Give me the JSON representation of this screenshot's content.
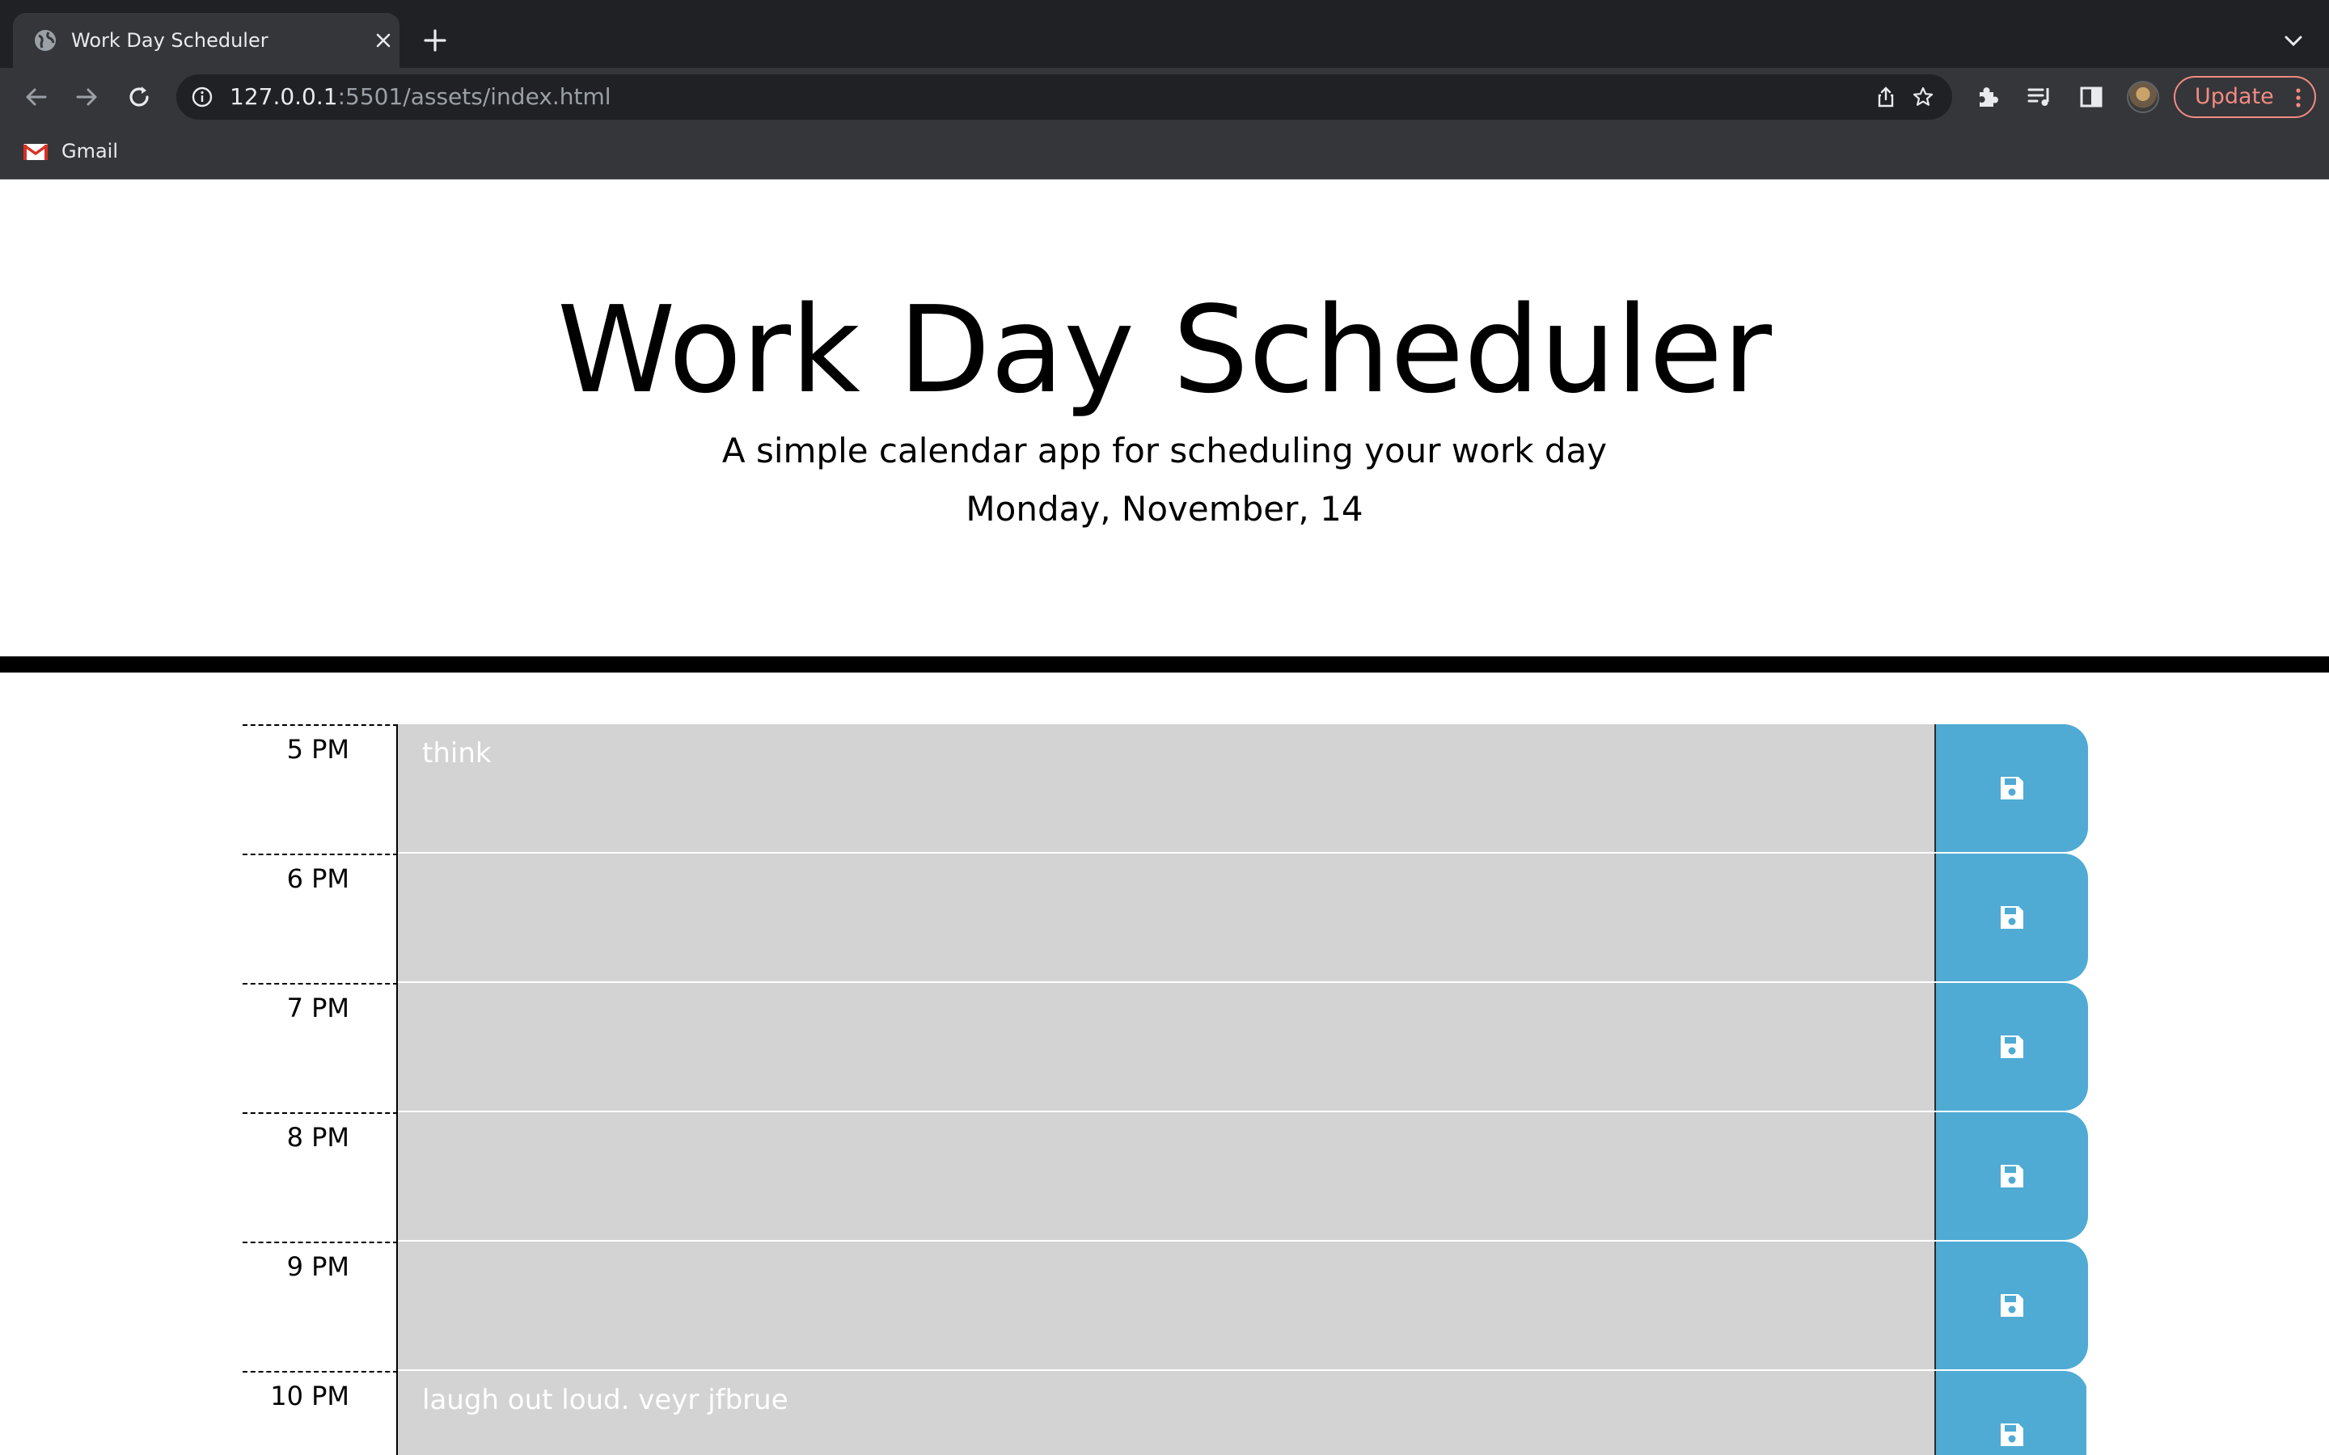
{
  "browser": {
    "tab_title": "Work Day Scheduler",
    "url_host": "127.0.0.1",
    "url_rest": ":5501/assets/index.html",
    "update_label": "Update",
    "bookmarks": [
      {
        "label": "Gmail"
      }
    ]
  },
  "header": {
    "title": "Work Day Scheduler",
    "lead": "A simple calendar app for scheduling your work day",
    "current_day": "Monday, November, 14"
  },
  "time_blocks": [
    {
      "hour": "5 PM",
      "text": "think"
    },
    {
      "hour": "6 PM",
      "text": ""
    },
    {
      "hour": "7 PM",
      "text": ""
    },
    {
      "hour": "8 PM",
      "text": ""
    },
    {
      "hour": "9 PM",
      "text": ""
    },
    {
      "hour": "10 PM",
      "text": "laugh out loud. veyr jfbrue"
    }
  ],
  "colors": {
    "past": "#d3d3d3",
    "save_button": "#4fabd4",
    "chrome_dark": "#202124",
    "chrome_toolbar": "#35363a",
    "update_accent": "#f28b82"
  },
  "icons": {
    "save": "floppy-disk-icon",
    "favicon": "globe-icon"
  }
}
